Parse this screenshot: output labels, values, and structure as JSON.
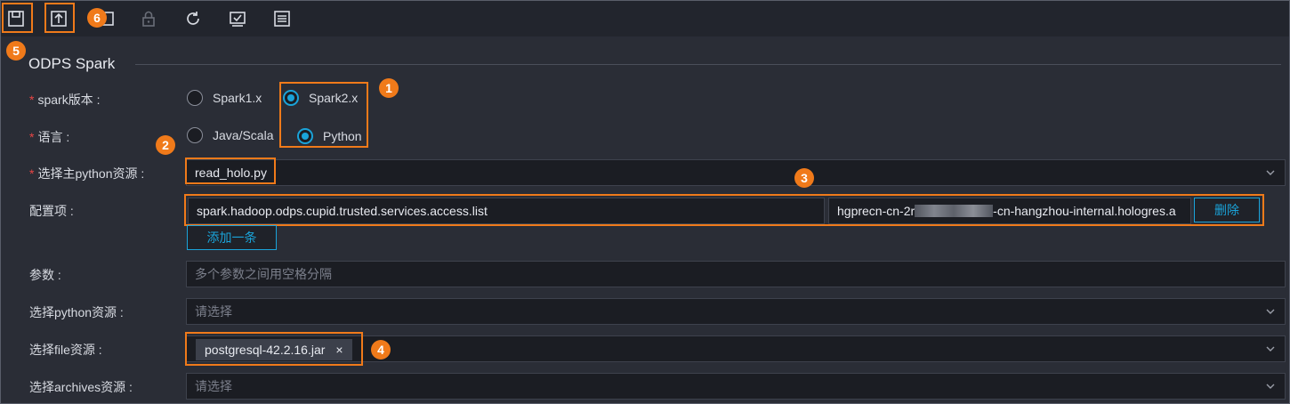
{
  "section": {
    "title": "ODPS Spark"
  },
  "form": {
    "spark_version": {
      "label": "spark版本 :",
      "options": [
        "Spark1.x",
        "Spark2.x"
      ],
      "selected": "Spark2.x"
    },
    "language": {
      "label": "语言 :",
      "options": [
        "Java/Scala",
        "Python"
      ],
      "selected": "Python"
    },
    "main_python_resource": {
      "label": "选择主python资源 :",
      "value": "read_holo.py"
    },
    "config": {
      "label": "配置项 :",
      "key": "spark.hadoop.odps.cupid.trusted.services.access.list",
      "value_prefix": "hgprecn-cn-2r",
      "value_suffix": "-cn-hangzhou-internal.hologres.a",
      "delete_label": "删除",
      "add_label": "添加一条"
    },
    "params": {
      "label": "参数 :",
      "placeholder": "多个参数之间用空格分隔"
    },
    "python_resource": {
      "label": "选择python资源 :",
      "placeholder": "请选择"
    },
    "file_resource": {
      "label": "选择file资源 :",
      "tag": "postgresql-42.2.16.jar",
      "tag_close": "×"
    },
    "archives_resource": {
      "label": "选择archives资源 :",
      "placeholder": "请选择"
    }
  },
  "callouts": [
    "1",
    "2",
    "3",
    "4",
    "5",
    "6"
  ],
  "colors": {
    "accent": "#1aa3d9",
    "callout": "#f07a1a",
    "required": "#e84545"
  },
  "icons": [
    "save-icon",
    "submit-icon",
    "copy-icon",
    "lock-icon",
    "refresh-icon",
    "check-icon",
    "list-icon",
    "chevron-down-icon"
  ]
}
